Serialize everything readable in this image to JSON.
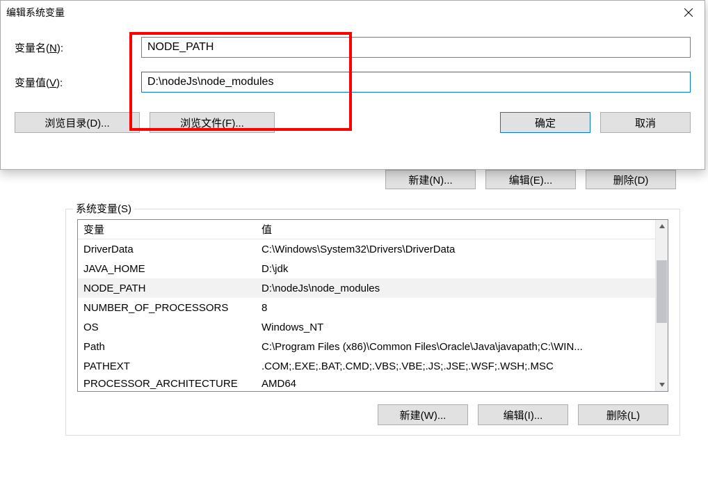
{
  "editDialog": {
    "title": "编辑系统变量",
    "nameLabelPrefix": "变量名(",
    "nameShortcut": "N",
    "nameLabelSuffix": "):",
    "nameValue": "NODE_PATH",
    "valueLabelPrefix": "变量值(",
    "valueShortcut": "V",
    "valueLabelSuffix": "):",
    "valueValue": "D:\\nodeJs\\node_modules",
    "browseDir": "浏览目录(D)...",
    "browseFile": "浏览文件(F)...",
    "ok": "确定",
    "cancel": "取消"
  },
  "bgPartial": {
    "newBtn": "新建(N)...",
    "editBtn": "编辑(E)...",
    "deleteBtn": "删除(D)"
  },
  "sysVars": {
    "groupLabel": "系统变量(S)",
    "headerName": "变量",
    "headerValue": "值",
    "rows": [
      {
        "name": "DriverData",
        "value": "C:\\Windows\\System32\\Drivers\\DriverData"
      },
      {
        "name": "JAVA_HOME",
        "value": "D:\\jdk"
      },
      {
        "name": "NODE_PATH",
        "value": "D:\\nodeJs\\node_modules",
        "selected": true
      },
      {
        "name": "NUMBER_OF_PROCESSORS",
        "value": "8"
      },
      {
        "name": "OS",
        "value": "Windows_NT"
      },
      {
        "name": "Path",
        "value": "C:\\Program Files (x86)\\Common Files\\Oracle\\Java\\javapath;C:\\WIN..."
      },
      {
        "name": "PATHEXT",
        "value": ".COM;.EXE;.BAT;.CMD;.VBS;.VBE;.JS;.JSE;.WSF;.WSH;.MSC"
      },
      {
        "name": "PROCESSOR_ARCHITECTURE",
        "value": "AMD64"
      }
    ],
    "newBtn": "新建(W)...",
    "editBtn": "编辑(I)...",
    "deleteBtn": "删除(L)"
  }
}
